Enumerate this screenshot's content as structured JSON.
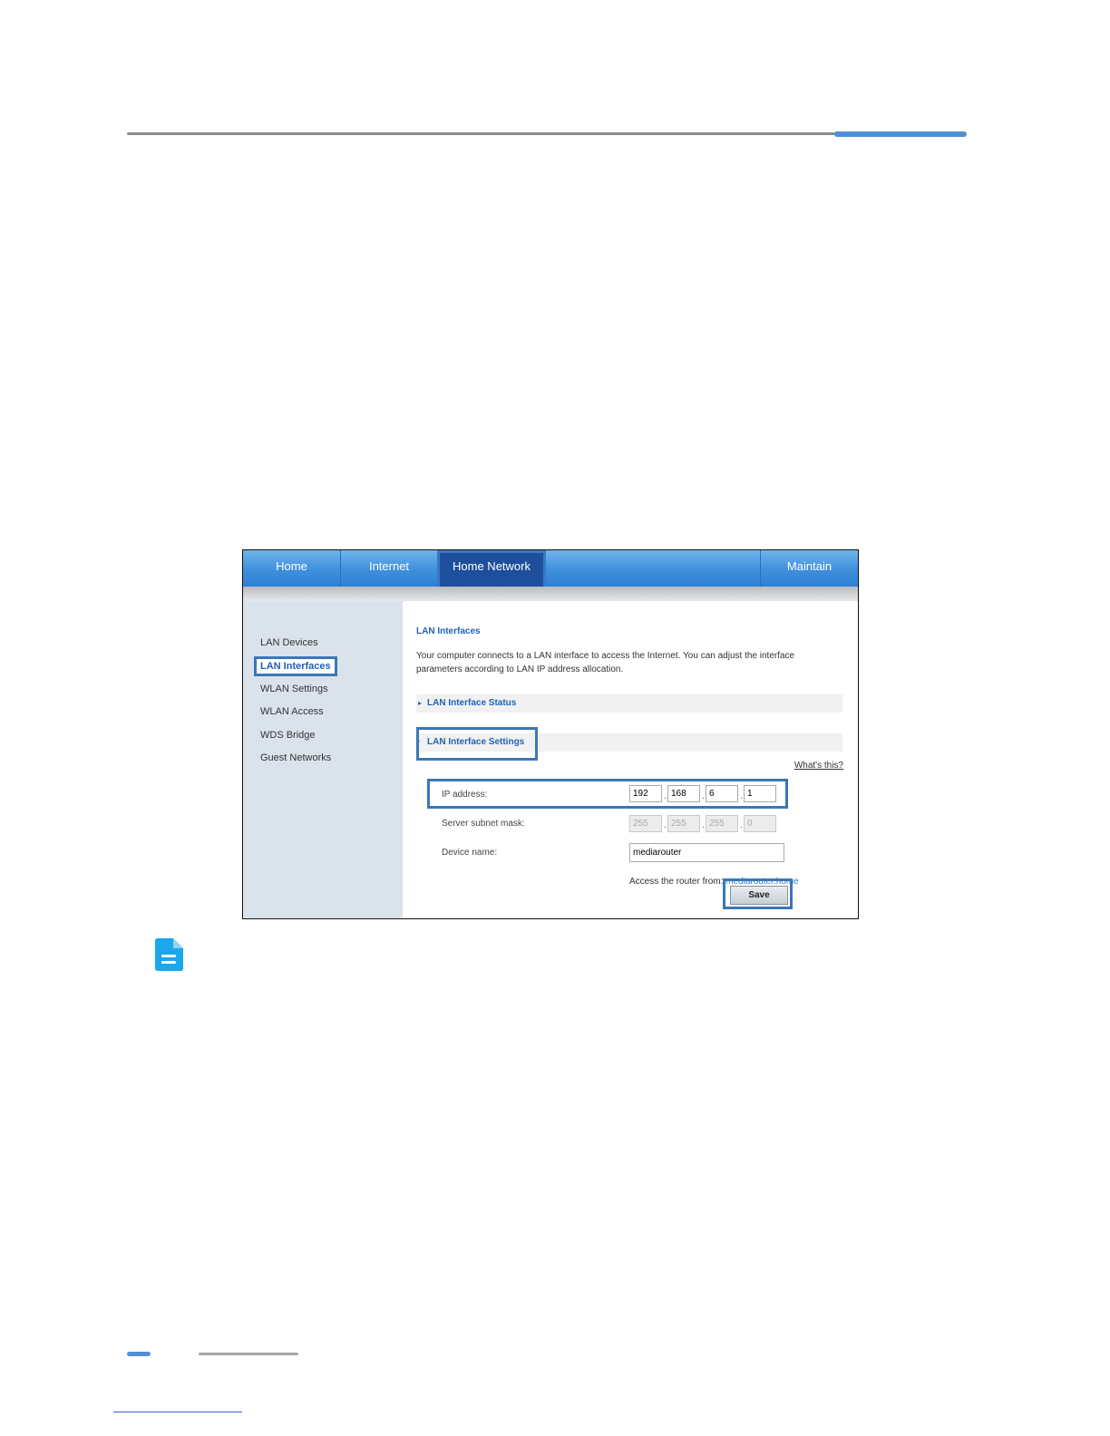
{
  "nav": {
    "tabs": [
      {
        "label": "Home"
      },
      {
        "label": "Internet"
      },
      {
        "label": "Home Network"
      },
      {
        "label": "Maintain"
      }
    ]
  },
  "sidebar": {
    "items": [
      {
        "label": "LAN Devices"
      },
      {
        "label": "LAN Interfaces"
      },
      {
        "label": "WLAN Settings"
      },
      {
        "label": "WLAN Access"
      },
      {
        "label": "WDS Bridge"
      },
      {
        "label": "Guest Networks"
      }
    ]
  },
  "main": {
    "title": "LAN Interfaces",
    "description": "Your computer connects to a LAN interface to access the Internet. You can adjust the interface parameters according to LAN IP address allocation.",
    "section_status": "LAN Interface Status",
    "section_settings": "LAN Interface Settings",
    "whats_this": "What's this?",
    "ip_label": "IP address:",
    "ip": [
      "192",
      "168",
      "6",
      "1"
    ],
    "mask_label": "Server subnet mask:",
    "mask": [
      "255",
      "255",
      "255",
      "0"
    ],
    "device_label": "Device name:",
    "device_name": "mediarouter",
    "access_text": "Access the router from:",
    "access_link": "mediarouter.home",
    "save_label": "Save"
  },
  "icons": {
    "note": "note-document-icon",
    "section_collapsed": "chevron-right-icon",
    "section_expanded": "chevron-down-icon"
  },
  "colors": {
    "accent": "#4f8fd8",
    "nav_active": "#1e4f9c",
    "highlight": "#3b77b8",
    "link": "#1f63b9"
  }
}
